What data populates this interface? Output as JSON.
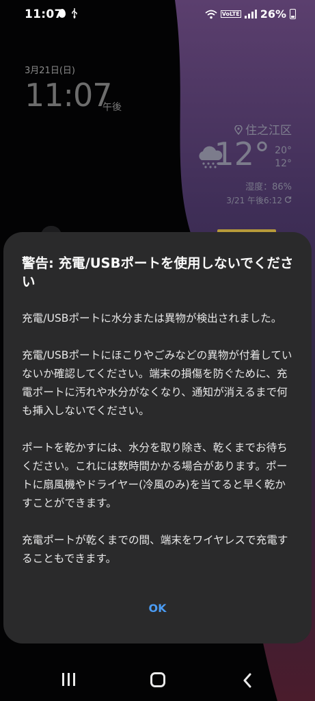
{
  "status_bar": {
    "time": "11:07",
    "battery": "26%",
    "icons": [
      "drop-icon",
      "usb-icon",
      "wifi-icon",
      "volte-icon",
      "signal-icon",
      "battery-icon"
    ]
  },
  "lockscreen": {
    "date": "3月21日(日)",
    "time": "11:07",
    "ampm": "午後"
  },
  "weather": {
    "location": "住之江区",
    "temp": "12°",
    "high": "20°",
    "low": "12°",
    "humidity": "湿度：86%",
    "updated": "3/21 午後6:12",
    "icon": "rain-cloud-icon"
  },
  "dialog": {
    "title": "警告: 充電/USBポートを使用しないでください",
    "paragraphs": [
      "充電/USBポートに水分または異物が検出されました。",
      "充電/USBポートにほこりやごみなどの異物が付着していないか確認してください。端末の損傷を防ぐために、充電ポートに汚れや水分がなくなり、通知が消えるまで何も挿入しないでください。",
      "ポートを乾かすには、水分を取り除き、乾くまでお待ちください。これには数時間かかる場合があります。ポートに扇風機やドライヤー(冷風のみ)を当てると早く乾かすことができます。",
      "充電ポートが乾くまでの間、端末をワイヤレスで充電することもできます。"
    ],
    "ok_label": "OK"
  },
  "nav": {
    "icons": [
      "recents-icon",
      "home-icon",
      "back-icon"
    ]
  },
  "colors": {
    "dialog_bg": "#2a2a2b",
    "accent": "#4b9cf4"
  }
}
